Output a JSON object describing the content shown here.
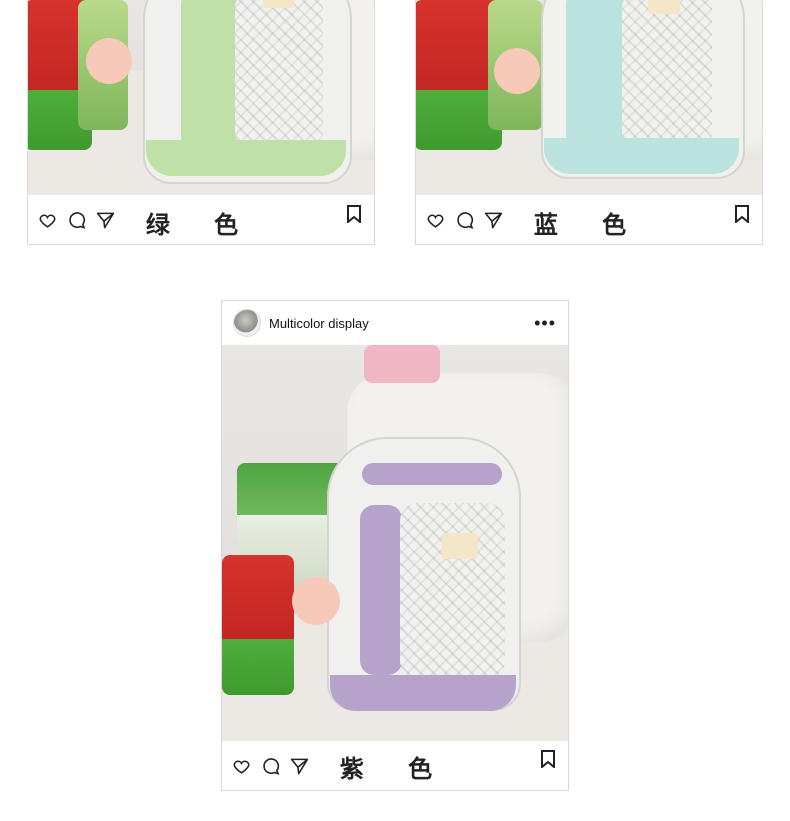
{
  "cards": [
    {
      "id": "green",
      "label": "绿 色",
      "accent": "#bfe0a6",
      "accent_dark": "#9ccc7d"
    },
    {
      "id": "blue",
      "label": "蓝 色",
      "accent": "#b9e3dc",
      "accent_dark": "#8fd0c7"
    },
    {
      "id": "purple",
      "label": "紫 色",
      "accent": "#b7a2cc",
      "accent_dark": "#9a80b6",
      "username": "Multicolor display"
    }
  ],
  "icons": {
    "like": "heart-icon",
    "comment": "comment-icon",
    "share": "send-icon",
    "save": "bookmark-icon",
    "more": "more-options-icon"
  }
}
